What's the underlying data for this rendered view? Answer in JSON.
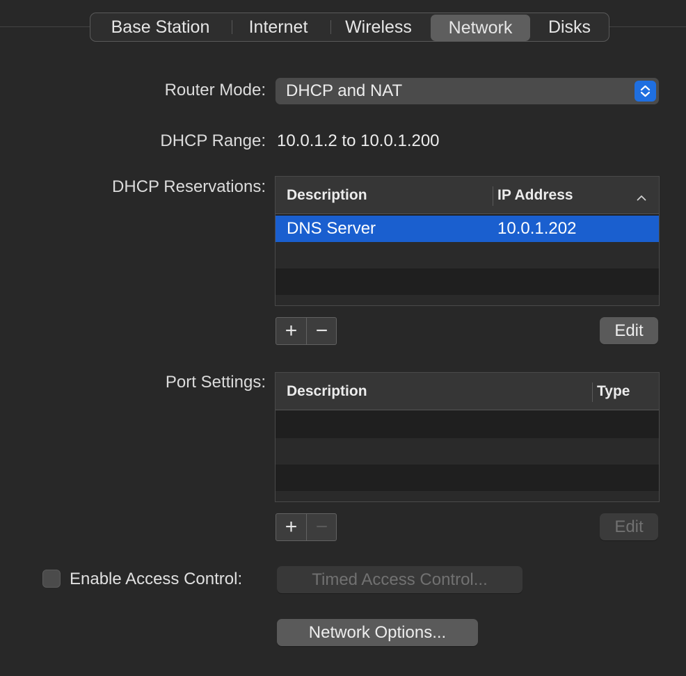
{
  "tabs": [
    {
      "label": "Base Station",
      "active": false
    },
    {
      "label": "Internet",
      "active": false
    },
    {
      "label": "Wireless",
      "active": false
    },
    {
      "label": "Network",
      "active": true
    },
    {
      "label": "Disks",
      "active": false
    }
  ],
  "router_mode": {
    "label": "Router Mode:",
    "value": "DHCP and NAT"
  },
  "dhcp_range": {
    "label": "DHCP Range:",
    "value": "10.0.1.2 to 10.0.1.200"
  },
  "dhcp_reservations": {
    "label": "DHCP Reservations:",
    "columns": [
      "Description",
      "IP Address"
    ],
    "sort_indicator": "chevron-up-icon",
    "rows": [
      {
        "description": "DNS Server",
        "ip": "10.0.1.202",
        "selected": true
      }
    ],
    "add_label": "+",
    "remove_label": "−",
    "edit_label": "Edit"
  },
  "port_settings": {
    "label": "Port Settings:",
    "columns": [
      "Description",
      "Type"
    ],
    "rows": [],
    "add_label": "+",
    "remove_label": "−",
    "edit_label": "Edit"
  },
  "access_control": {
    "checkbox_label": "Enable Access Control:",
    "checked": false,
    "timed_button": "Timed Access Control..."
  },
  "network_options_button": "Network Options...",
  "colors": {
    "selection": "#1a5fcf",
    "accent": "#1f6fe0",
    "background": "#282828"
  }
}
